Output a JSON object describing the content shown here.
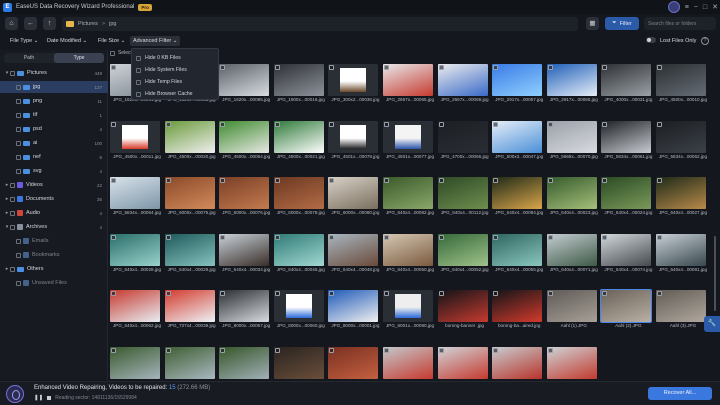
{
  "app": {
    "title": "EaseUS Data Recovery Wizard Professional",
    "badge": "Pro",
    "logo_letter": "E"
  },
  "window_controls": [
    "≡",
    "−",
    "□",
    "✕"
  ],
  "nav": {
    "home": "⌂",
    "back": "←",
    "up": "↑"
  },
  "breadcrumb": [
    "Pictures",
    ">",
    "jpg"
  ],
  "toolbar": {
    "view_icon": "▦",
    "filter_label": "Filter",
    "filter_icon": "⏷",
    "search_placeholder": "Search files or folders"
  },
  "filters": {
    "file_type": "File Type ⌄",
    "date_modified": "Date Modified ⌄",
    "file_size": "File Size ⌄",
    "advanced_filter": "Advanced Filter ⌄",
    "lost_files_only": "Lost Files Only",
    "help": "?"
  },
  "advanced_filter_menu": [
    "Hide 0 KB Files",
    "Hide System Files",
    "Hide Temp Files",
    "Hide Browser Cache"
  ],
  "select_all": "Select",
  "sidebar": {
    "tabs": [
      "Path",
      "Type"
    ],
    "active_tab": "Type",
    "items": [
      {
        "label": "Pictures",
        "count": "449",
        "level": 0,
        "caret": "▾",
        "icon": "folder-icon"
      },
      {
        "label": "jpg",
        "count": "127",
        "level": 1,
        "caret": "",
        "icon": "folder-icon",
        "selected": true
      },
      {
        "label": "png",
        "count": "11",
        "level": 1,
        "caret": "",
        "icon": "folder-icon"
      },
      {
        "label": "tif",
        "count": "1",
        "level": 1,
        "caret": "",
        "icon": "folder-icon"
      },
      {
        "label": "psd",
        "count": "4",
        "level": 1,
        "caret": "",
        "icon": "folder-icon"
      },
      {
        "label": "ai",
        "count": "100",
        "level": 1,
        "caret": "",
        "icon": "folder-icon"
      },
      {
        "label": "nef",
        "count": "6",
        "level": 1,
        "caret": "",
        "icon": "folder-icon"
      },
      {
        "label": "svg",
        "count": "4",
        "level": 1,
        "caret": "",
        "icon": "folder-icon"
      },
      {
        "label": "Videos",
        "count": "22",
        "level": 0,
        "caret": "▸",
        "icon": "video-icon"
      },
      {
        "label": "Documents",
        "count": "35",
        "level": 0,
        "caret": "▸",
        "icon": "document-icon"
      },
      {
        "label": "Audio",
        "count": "4",
        "level": 0,
        "caret": "▸",
        "icon": "audio-icon"
      },
      {
        "label": "Archives",
        "count": "4",
        "level": 0,
        "caret": "▾",
        "icon": "archive-icon"
      },
      {
        "label": "Emails",
        "count": "",
        "level": 1,
        "caret": "",
        "icon": "email-icon",
        "dim": true
      },
      {
        "label": "Bookmarks",
        "count": "",
        "level": 1,
        "caret": "",
        "icon": "bookmark-icon",
        "dim": true
      },
      {
        "label": "Others",
        "count": "",
        "level": 0,
        "caret": "▸",
        "icon": "folder-icon"
      },
      {
        "label": "Unsaved Files",
        "count": "",
        "level": 1,
        "caret": "",
        "icon": "file-icon",
        "dim": true
      }
    ]
  },
  "files": [
    {
      "name": "JPG_1620x...00081.jpg",
      "thumb": "photo",
      "c1": "#cfd3d8",
      "c2": "#7d8790"
    },
    {
      "name": "JPG_1620x...00083.jpg",
      "thumb": "photo",
      "c1": "#4a4f56",
      "c2": "#9da4ab"
    },
    {
      "name": "JPG_1620x...00085.jpg",
      "thumb": "photo",
      "c1": "#5b6168",
      "c2": "#d9dde2"
    },
    {
      "name": "JPG_1900x...00016.jpg",
      "thumb": "photo",
      "c1": "#2e3136",
      "c2": "#8d939b"
    },
    {
      "name": "JPG_300x2...00036.jpg",
      "thumb": "paper",
      "c1": "#ffffff",
      "c2": "#6b4a2c"
    },
    {
      "name": "JPG_2667x...00065.jpg",
      "thumb": "photo",
      "c1": "#e8e8ea",
      "c2": "#c63a2f"
    },
    {
      "name": "JPG_2667x...00069.jpg",
      "thumb": "photo",
      "c1": "#ededee",
      "c2": "#3a6ac8"
    },
    {
      "name": "JPG_2917x...00057.jpg",
      "thumb": "photo",
      "c1": "#3a7be6",
      "c2": "#8fd0ff"
    },
    {
      "name": "JPG_2917x...00065.jpg",
      "thumb": "photo",
      "c1": "#1f5fb8",
      "c2": "#e6eef8"
    },
    {
      "name": "JPG_4000x...00031.jpg",
      "thumb": "photo",
      "c1": "#2e3134",
      "c2": "#9aa0a6"
    },
    {
      "name": "JPG_4500x...00010.jpg",
      "thumb": "photo",
      "c1": "#2b2f33",
      "c2": "#656c74"
    },
    {
      "name": "JPG_4500x...00011.jpg",
      "thumb": "paper",
      "c1": "#ffffff",
      "c2": "#d63a2a"
    },
    {
      "name": "JPG_4500x...00020.jpg",
      "thumb": "photo",
      "c1": "#6a9a3a",
      "c2": "#f0f0f0"
    },
    {
      "name": "JPG_4500x...00064.jpg",
      "thumb": "photo",
      "c1": "#3e8a2e",
      "c2": "#e7e9e4"
    },
    {
      "name": "JPG_4500x...00021.jpg",
      "thumb": "photo",
      "c1": "#2f7a3a",
      "c2": "#ffffff"
    },
    {
      "name": "JPG_4501x...00078.jpg",
      "thumb": "paper",
      "c1": "#ffffff",
      "c2": "#222222"
    },
    {
      "name": "JPG_4501x...00077.jpg",
      "thumb": "paper",
      "c1": "#f4f4f4",
      "c2": "#2a52a8"
    },
    {
      "name": "JPG_4700x...00066.jpg",
      "thumb": "photo",
      "c1": "#1c1f24",
      "c2": "#2a2e34"
    },
    {
      "name": "JPG_500x3...00047.jpg",
      "thumb": "photo",
      "c1": "#e6eef8",
      "c2": "#4a8fd8"
    },
    {
      "name": "JPG_5668x...00070.jpg",
      "thumb": "photo",
      "c1": "#9aa0a8",
      "c2": "#d8dbe0"
    },
    {
      "name": "JPG_5834x...00061.jpg",
      "thumb": "photo",
      "c1": "#1e2125",
      "c2": "#c8ccd2"
    },
    {
      "name": "JPG_5834x...00062.jpg",
      "thumb": "photo",
      "c1": "#1b1e22",
      "c2": "#3c4148"
    },
    {
      "name": "JPG_5834x...00064.jpg",
      "thumb": "photo",
      "c1": "#d9e2ea",
      "c2": "#7d96a8"
    },
    {
      "name": "JPG_6000x...00075.jpg",
      "thumb": "photo",
      "c1": "#8a4a2a",
      "c2": "#d38a5a"
    },
    {
      "name": "JPG_6000x...00076.jpg",
      "thumb": "photo",
      "c1": "#7a3f27",
      "c2": "#c47a4e"
    },
    {
      "name": "JPG_6000x...00078.jpg",
      "thumb": "photo",
      "c1": "#6c3822",
      "c2": "#b36c45"
    },
    {
      "name": "JPG_6000x...00080.jpg",
      "thumb": "photo",
      "c1": "#d8d2c8",
      "c2": "#7a6e5e"
    },
    {
      "name": "JPG_640x4...00082.jpg",
      "thumb": "photo",
      "c1": "#3a5a2a",
      "c2": "#8aa86a"
    },
    {
      "name": "JPG_640x4...00112.jpg",
      "thumb": "photo",
      "c1": "#2e4a26",
      "c2": "#6e8e4e"
    },
    {
      "name": "JPG_640x4...00084.jpg",
      "thumb": "photo",
      "c1": "#1e2a18",
      "c2": "#d9a54a"
    },
    {
      "name": "JPG_640x4...00023.jpg",
      "thumb": "photo",
      "c1": "#355a2c",
      "c2": "#a6c07a"
    },
    {
      "name": "JPG_640x4...00024.jpg",
      "thumb": "photo",
      "c1": "#2b4a24",
      "c2": "#7a9a5a"
    },
    {
      "name": "JPG_640x4...00027.jpg",
      "thumb": "photo",
      "c1": "#1e2a18",
      "c2": "#b88a4a"
    },
    {
      "name": "JPG_640x4...00028.jpg",
      "thumb": "photo",
      "c1": "#2a6e6a",
      "c2": "#9ad2cc"
    },
    {
      "name": "JPG_640x4...00029.jpg",
      "thumb": "photo",
      "c1": "#1e5a5a",
      "c2": "#86c2be"
    },
    {
      "name": "JPG_640x4...00034.jpg",
      "thumb": "photo",
      "c1": "#c8d2da",
      "c2": "#3a2e28"
    },
    {
      "name": "JPG_640x4...00045.jpg",
      "thumb": "photo",
      "c1": "#2f7a76",
      "c2": "#a2d8d2"
    },
    {
      "name": "JPG_640x4...00048.jpg",
      "thumb": "photo",
      "c1": "#a8b6c0",
      "c2": "#6a4a3a"
    },
    {
      "name": "JPG_640x4...00050.jpg",
      "thumb": "photo",
      "c1": "#d6c8b4",
      "c2": "#7a5a3e"
    },
    {
      "name": "JPG_640x4...00052.jpg",
      "thumb": "photo",
      "c1": "#356a3a",
      "c2": "#a0c28a"
    },
    {
      "name": "JPG_640x4...00055.jpg",
      "thumb": "photo",
      "c1": "#2e6660",
      "c2": "#8ac6be"
    },
    {
      "name": "JPG_640x4...00071.jpg",
      "thumb": "photo",
      "c1": "#c4ccd2",
      "c2": "#3e5a46"
    },
    {
      "name": "JPG_640x4...00074.jpg",
      "thumb": "photo",
      "c1": "#d2d8dc",
      "c2": "#444a4e"
    },
    {
      "name": "JPG_640x4...00081.jpg",
      "thumb": "photo",
      "c1": "#c8d0d6",
      "c2": "#38484e"
    },
    {
      "name": "JPG_640x4...00062.jpg",
      "thumb": "photo",
      "c1": "#c63a2f",
      "c2": "#e8eef4"
    },
    {
      "name": "JPG_727x4...00039.jpg",
      "thumb": "photo",
      "c1": "#d23a2c",
      "c2": "#eef2f6"
    },
    {
      "name": "JPG_8000x...00067.jpg",
      "thumb": "photo",
      "c1": "#2a2e32",
      "c2": "#d8dce0"
    },
    {
      "name": "JPG_8000x...00060.jpg",
      "thumb": "paper",
      "c1": "#ffffff",
      "c2": "#2a6ad8"
    },
    {
      "name": "JPG_8000x...00001.jpg",
      "thumb": "photo",
      "c1": "#1f5ab8",
      "c2": "#f0f0f0"
    },
    {
      "name": "JPG_6001x...00080.jpg",
      "thumb": "paper",
      "c1": "#eeeeee",
      "c2": "#2a6ad8"
    },
    {
      "name": "borong-banner .jpg",
      "thumb": "photo",
      "c1": "#121418",
      "c2": "#c63a2f"
    },
    {
      "name": "borong-ba...aired.jpg",
      "thumb": "photo",
      "c1": "#121418",
      "c2": "#d23a2c"
    },
    {
      "name": "Aahl (1).JPG",
      "thumb": "photo",
      "c1": "#5e5a56",
      "c2": "#a8a098"
    },
    {
      "name": "Aahl (2).JPG",
      "thumb": "photo",
      "c1": "#6a625a",
      "c2": "#bab0a4",
      "picked": true
    },
    {
      "name": "Aahl (3).JPG",
      "thumb": "photo",
      "c1": "#625c56",
      "c2": "#b0a89e"
    },
    {
      "name": "Gorkhey (1).JPG",
      "thumb": "photo",
      "c1": "#3a5a2e",
      "c2": "#a6b4bc"
    },
    {
      "name": "Gorkhey (2).JPG",
      "thumb": "photo",
      "c1": "#3e5e32",
      "c2": "#aab8c0"
    },
    {
      "name": "Gorkhey (3).JPG",
      "thumb": "photo",
      "c1": "#365628",
      "c2": "#a2b0b8"
    },
    {
      "name": "",
      "thumb": "photo",
      "c1": "#2a2420",
      "c2": "#6a4e3a"
    },
    {
      "name": "",
      "thumb": "photo",
      "c1": "#7a3022",
      "c2": "#c46040"
    },
    {
      "name": "",
      "thumb": "photo",
      "c1": "#c4c8cc",
      "c2": "#c63a2f"
    },
    {
      "name": "",
      "thumb": "photo",
      "c1": "#d0d4d8",
      "c2": "#c63a2f"
    },
    {
      "name": "",
      "thumb": "photo",
      "c1": "#c8ccd0",
      "c2": "#b8342a"
    },
    {
      "name": "",
      "thumb": "photo",
      "c1": "#cfd3d7",
      "c2": "#c23a2e"
    }
  ],
  "bottom": {
    "title_prefix": "Enhanced Video Repairing, Videos to be repaired:",
    "count": "15",
    "size": "(272.66 MB)",
    "pause_icon": "❚❚",
    "status": "Reading sector: 14811136/15529984",
    "recover_button": "Recover All..."
  },
  "float_tool_icon": "🔧"
}
